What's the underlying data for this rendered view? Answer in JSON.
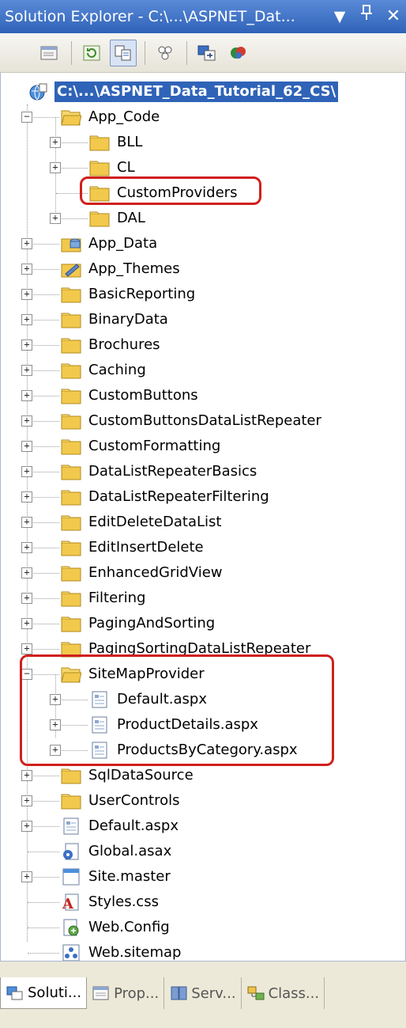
{
  "window": {
    "title": "Solution Explorer - C:\\...\\ASPNET_Dat...",
    "dropdown_glyph": "▼",
    "pin_glyph": "ᵾ",
    "close_glyph": "✕"
  },
  "toolbar": {
    "buttons": [
      {
        "name": "properties-icon"
      },
      {
        "name": "refresh-icon"
      },
      {
        "name": "nest-related-files-icon"
      },
      {
        "name": "view-class-diagram-icon"
      },
      {
        "name": "copy-website-icon"
      },
      {
        "name": "asp-net-configuration-icon"
      }
    ]
  },
  "tree": {
    "root": "C:\\...\\ASPNET_Data_Tutorial_62_CS\\",
    "items": [
      {
        "label": "App_Code",
        "expander": "−"
      },
      {
        "label": "BLL",
        "expander": "+"
      },
      {
        "label": "CL",
        "expander": "+"
      },
      {
        "label": "CustomProviders",
        "expander": ""
      },
      {
        "label": "DAL",
        "expander": "+"
      },
      {
        "label": "App_Data",
        "expander": "+"
      },
      {
        "label": "App_Themes",
        "expander": "+"
      },
      {
        "label": "BasicReporting",
        "expander": "+"
      },
      {
        "label": "BinaryData",
        "expander": "+"
      },
      {
        "label": "Brochures",
        "expander": "+"
      },
      {
        "label": "Caching",
        "expander": "+"
      },
      {
        "label": "CustomButtons",
        "expander": "+"
      },
      {
        "label": "CustomButtonsDataListRepeater",
        "expander": "+"
      },
      {
        "label": "CustomFormatting",
        "expander": "+"
      },
      {
        "label": "DataListRepeaterBasics",
        "expander": "+"
      },
      {
        "label": "DataListRepeaterFiltering",
        "expander": "+"
      },
      {
        "label": "EditDeleteDataList",
        "expander": "+"
      },
      {
        "label": "EditInsertDelete",
        "expander": "+"
      },
      {
        "label": "EnhancedGridView",
        "expander": "+"
      },
      {
        "label": "Filtering",
        "expander": "+"
      },
      {
        "label": "PagingAndSorting",
        "expander": "+"
      },
      {
        "label": "PagingSortingDataListRepeater",
        "expander": "+"
      },
      {
        "label": "SiteMapProvider",
        "expander": "−"
      },
      {
        "label": "Default.aspx",
        "expander": "+"
      },
      {
        "label": "ProductDetails.aspx",
        "expander": "+"
      },
      {
        "label": "ProductsByCategory.aspx",
        "expander": "+"
      },
      {
        "label": "SqlDataSource",
        "expander": "+"
      },
      {
        "label": "UserControls",
        "expander": "+"
      },
      {
        "label": "Default.aspx",
        "expander": "+"
      },
      {
        "label": "Global.asax",
        "expander": ""
      },
      {
        "label": "Site.master",
        "expander": "+"
      },
      {
        "label": "Styles.css",
        "expander": ""
      },
      {
        "label": "Web.Config",
        "expander": ""
      },
      {
        "label": "Web.sitemap",
        "expander": ""
      }
    ]
  },
  "tabs": [
    {
      "label": "Soluti..."
    },
    {
      "label": "Prop..."
    },
    {
      "label": "Serv..."
    },
    {
      "label": "Class..."
    }
  ],
  "colors": {
    "title_bar": "#2f63b8",
    "selection": "#2f63b8",
    "highlight_box": "#d0201d",
    "folder": "#f2c94c"
  }
}
